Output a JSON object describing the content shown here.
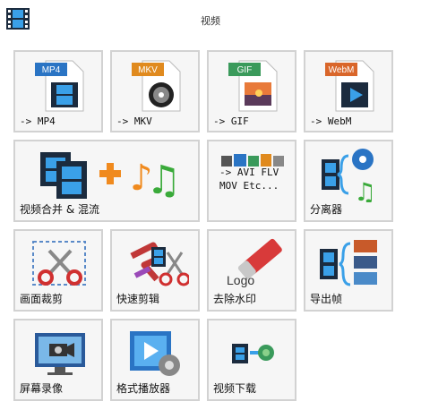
{
  "window": {
    "title": "视频"
  },
  "tiles": [
    {
      "label": "-> MP4",
      "badge": "MP4",
      "color": "#2a74c4",
      "icon": "mp4-file-icon"
    },
    {
      "label": "-> MKV",
      "badge": "MKV",
      "color": "#e08a1e",
      "icon": "mkv-file-icon"
    },
    {
      "label": "-> GIF",
      "badge": "GIF",
      "color": "#3a9a5b",
      "icon": "gif-file-icon"
    },
    {
      "label": "-> WebM",
      "badge": "WebM",
      "color": "#d9662a",
      "icon": "webm-file-icon"
    },
    {
      "label": "视频合并 & 混流",
      "icon": "merge-video-music-icon"
    },
    {
      "label_lines": "-> AVI FLV\nMOV Etc...",
      "icon": "format-strip-icon"
    },
    {
      "label": "分离器",
      "icon": "splitter-icon"
    },
    {
      "label": "画面裁剪",
      "icon": "crop-scissors-icon"
    },
    {
      "label": "快速剪辑",
      "icon": "quick-cut-icon"
    },
    {
      "label": "去除水印",
      "icon": "eraser-logo-icon"
    },
    {
      "label": "导出帧",
      "icon": "export-frames-icon"
    },
    {
      "label": "屏幕录像",
      "icon": "screen-record-icon"
    },
    {
      "label": "格式播放器",
      "icon": "format-player-icon"
    },
    {
      "label": "视频下载",
      "icon": "video-download-icon"
    }
  ]
}
